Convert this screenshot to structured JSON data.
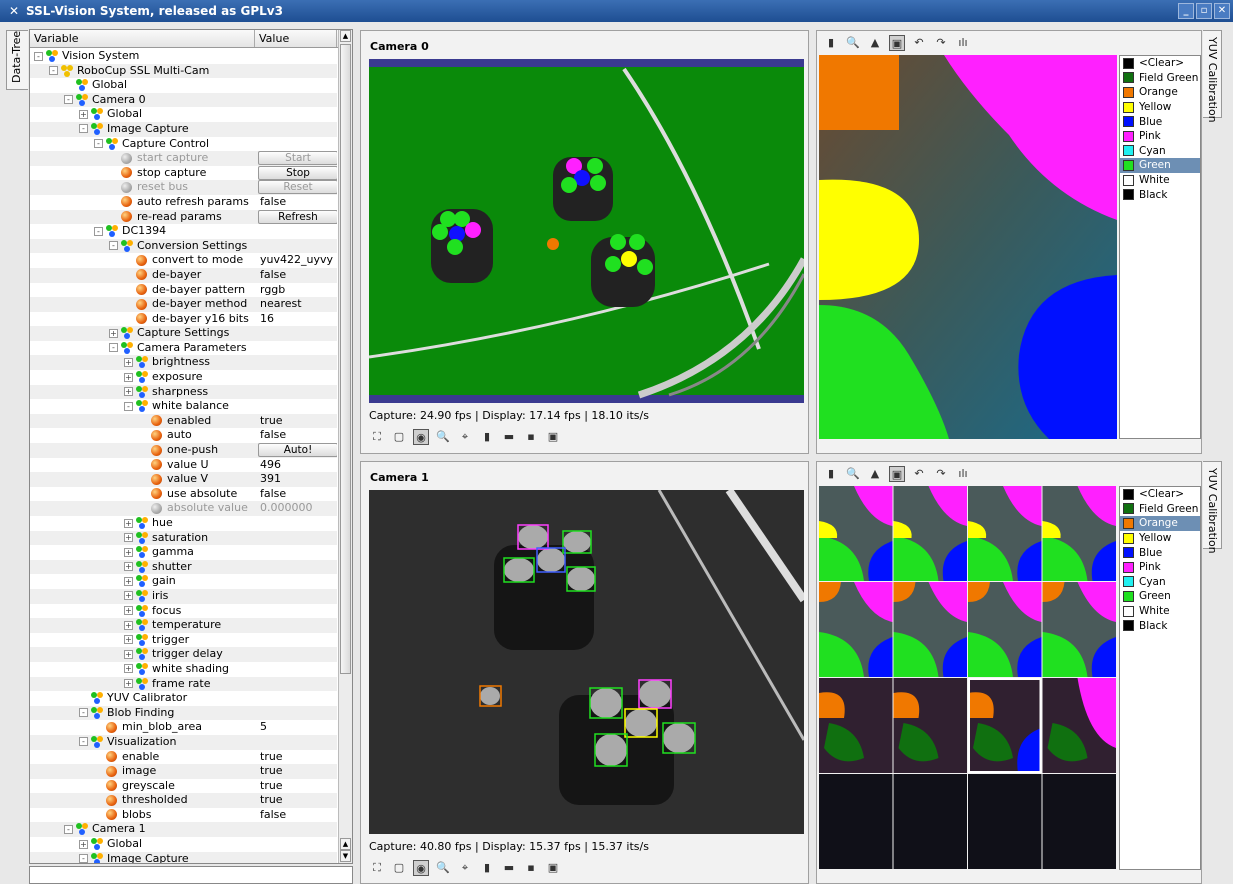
{
  "window": {
    "title": "SSL-Vision System, released as GPLv3"
  },
  "left_tab": "Data-Tree",
  "right_tab": "YUV Calibration",
  "tree": {
    "col_variable": "Variable",
    "col_value": "Value",
    "rows": [
      {
        "indent": 0,
        "exp": "-",
        "icon": "group",
        "label": "Vision System",
        "value": ""
      },
      {
        "indent": 1,
        "exp": "-",
        "icon": "camera",
        "label": "RoboCup SSL Multi-Cam",
        "value": ""
      },
      {
        "indent": 2,
        "exp": "",
        "icon": "group",
        "label": "Global",
        "value": ""
      },
      {
        "indent": 2,
        "exp": "-",
        "icon": "group",
        "label": "Camera 0",
        "value": ""
      },
      {
        "indent": 3,
        "exp": "+",
        "icon": "group",
        "label": "Global",
        "value": ""
      },
      {
        "indent": 3,
        "exp": "-",
        "icon": "group",
        "label": "Image Capture",
        "value": ""
      },
      {
        "indent": 4,
        "exp": "-",
        "icon": "group",
        "label": "Capture Control",
        "value": ""
      },
      {
        "indent": 5,
        "exp": "",
        "icon": "leaf-grey",
        "label": "start capture",
        "value": "",
        "button": "Start",
        "disabled": true
      },
      {
        "indent": 5,
        "exp": "",
        "icon": "leaf",
        "label": "stop capture",
        "value": "",
        "button": "Stop"
      },
      {
        "indent": 5,
        "exp": "",
        "icon": "leaf-grey",
        "label": "reset bus",
        "value": "",
        "button": "Reset",
        "disabled": true
      },
      {
        "indent": 5,
        "exp": "",
        "icon": "leaf",
        "label": "auto refresh params",
        "value": "false"
      },
      {
        "indent": 5,
        "exp": "",
        "icon": "leaf",
        "label": "re-read params",
        "value": "",
        "button": "Refresh"
      },
      {
        "indent": 4,
        "exp": "-",
        "icon": "group",
        "label": "DC1394",
        "value": ""
      },
      {
        "indent": 5,
        "exp": "-",
        "icon": "group",
        "label": "Conversion Settings",
        "value": ""
      },
      {
        "indent": 6,
        "exp": "",
        "icon": "leaf",
        "label": "convert to mode",
        "value": "yuv422_uyvy"
      },
      {
        "indent": 6,
        "exp": "",
        "icon": "leaf",
        "label": "de-bayer",
        "value": "false"
      },
      {
        "indent": 6,
        "exp": "",
        "icon": "leaf",
        "label": "de-bayer pattern",
        "value": "rggb"
      },
      {
        "indent": 6,
        "exp": "",
        "icon": "leaf",
        "label": "de-bayer method",
        "value": "nearest"
      },
      {
        "indent": 6,
        "exp": "",
        "icon": "leaf",
        "label": "de-bayer y16 bits",
        "value": "16"
      },
      {
        "indent": 5,
        "exp": "+",
        "icon": "group",
        "label": "Capture Settings",
        "value": ""
      },
      {
        "indent": 5,
        "exp": "-",
        "icon": "group",
        "label": "Camera Parameters",
        "value": ""
      },
      {
        "indent": 6,
        "exp": "+",
        "icon": "group",
        "label": "brightness",
        "value": ""
      },
      {
        "indent": 6,
        "exp": "+",
        "icon": "group",
        "label": "exposure",
        "value": ""
      },
      {
        "indent": 6,
        "exp": "+",
        "icon": "group",
        "label": "sharpness",
        "value": ""
      },
      {
        "indent": 6,
        "exp": "-",
        "icon": "group",
        "label": "white balance",
        "value": ""
      },
      {
        "indent": 7,
        "exp": "",
        "icon": "leaf",
        "label": "enabled",
        "value": "true"
      },
      {
        "indent": 7,
        "exp": "",
        "icon": "leaf",
        "label": "auto",
        "value": "false"
      },
      {
        "indent": 7,
        "exp": "",
        "icon": "leaf",
        "label": "one-push",
        "value": "",
        "button": "Auto!"
      },
      {
        "indent": 7,
        "exp": "",
        "icon": "leaf",
        "label": "value U",
        "value": "496",
        "editing": true
      },
      {
        "indent": 7,
        "exp": "",
        "icon": "leaf",
        "label": "value V",
        "value": "391"
      },
      {
        "indent": 7,
        "exp": "",
        "icon": "leaf",
        "label": "use absolute",
        "value": "false"
      },
      {
        "indent": 7,
        "exp": "",
        "icon": "leaf-grey",
        "label": "absolute value",
        "value": "0.000000",
        "disabled": true
      },
      {
        "indent": 6,
        "exp": "+",
        "icon": "group",
        "label": "hue",
        "value": ""
      },
      {
        "indent": 6,
        "exp": "+",
        "icon": "group",
        "label": "saturation",
        "value": ""
      },
      {
        "indent": 6,
        "exp": "+",
        "icon": "group",
        "label": "gamma",
        "value": ""
      },
      {
        "indent": 6,
        "exp": "+",
        "icon": "group",
        "label": "shutter",
        "value": ""
      },
      {
        "indent": 6,
        "exp": "+",
        "icon": "group",
        "label": "gain",
        "value": ""
      },
      {
        "indent": 6,
        "exp": "+",
        "icon": "group",
        "label": "iris",
        "value": ""
      },
      {
        "indent": 6,
        "exp": "+",
        "icon": "group",
        "label": "focus",
        "value": ""
      },
      {
        "indent": 6,
        "exp": "+",
        "icon": "group",
        "label": "temperature",
        "value": ""
      },
      {
        "indent": 6,
        "exp": "+",
        "icon": "group",
        "label": "trigger",
        "value": ""
      },
      {
        "indent": 6,
        "exp": "+",
        "icon": "group",
        "label": "trigger delay",
        "value": ""
      },
      {
        "indent": 6,
        "exp": "+",
        "icon": "group",
        "label": "white shading",
        "value": ""
      },
      {
        "indent": 6,
        "exp": "+",
        "icon": "group",
        "label": "frame rate",
        "value": ""
      },
      {
        "indent": 3,
        "exp": "",
        "icon": "group",
        "label": "YUV Calibrator",
        "value": ""
      },
      {
        "indent": 3,
        "exp": "-",
        "icon": "group",
        "label": "Blob Finding",
        "value": ""
      },
      {
        "indent": 4,
        "exp": "",
        "icon": "leaf",
        "label": "min_blob_area",
        "value": "5"
      },
      {
        "indent": 3,
        "exp": "-",
        "icon": "group",
        "label": "Visualization",
        "value": ""
      },
      {
        "indent": 4,
        "exp": "",
        "icon": "leaf",
        "label": "enable",
        "value": "true"
      },
      {
        "indent": 4,
        "exp": "",
        "icon": "leaf",
        "label": "image",
        "value": "true"
      },
      {
        "indent": 4,
        "exp": "",
        "icon": "leaf",
        "label": "greyscale",
        "value": "true"
      },
      {
        "indent": 4,
        "exp": "",
        "icon": "leaf",
        "label": "thresholded",
        "value": "true"
      },
      {
        "indent": 4,
        "exp": "",
        "icon": "leaf",
        "label": "blobs",
        "value": "false"
      },
      {
        "indent": 2,
        "exp": "-",
        "icon": "group",
        "label": "Camera 1",
        "value": ""
      },
      {
        "indent": 3,
        "exp": "+",
        "icon": "group",
        "label": "Global",
        "value": ""
      },
      {
        "indent": 3,
        "exp": "-",
        "icon": "group",
        "label": "Image Capture",
        "value": ""
      }
    ]
  },
  "cameras": [
    {
      "title": "Camera 0",
      "status": "Capture: 24.90 fps | Display: 17.14 fps | 18.10 its/s"
    },
    {
      "title": "Camera 1",
      "status": "Capture: 40.80 fps | Display: 15.37 fps | 15.37 its/s"
    }
  ],
  "legend": [
    {
      "label": "<Clear>",
      "color": "#000000"
    },
    {
      "label": "Field Green",
      "color": "#107010"
    },
    {
      "label": "Orange",
      "color": "#f07800"
    },
    {
      "label": "Yellow",
      "color": "#ffff00"
    },
    {
      "label": "Blue",
      "color": "#0010ff"
    },
    {
      "label": "Pink",
      "color": "#ff20ff"
    },
    {
      "label": "Cyan",
      "color": "#20f0f0"
    },
    {
      "label": "Green",
      "color": "#20e020"
    },
    {
      "label": "White",
      "color": "#ffffff"
    },
    {
      "label": "Black",
      "color": "#000000"
    }
  ],
  "legend_selected": [
    "Green",
    "Orange"
  ],
  "colors": {
    "title_bar": "#2a5ca3",
    "selection": "#6d8fb4",
    "field_green": "#0a8a0a"
  }
}
